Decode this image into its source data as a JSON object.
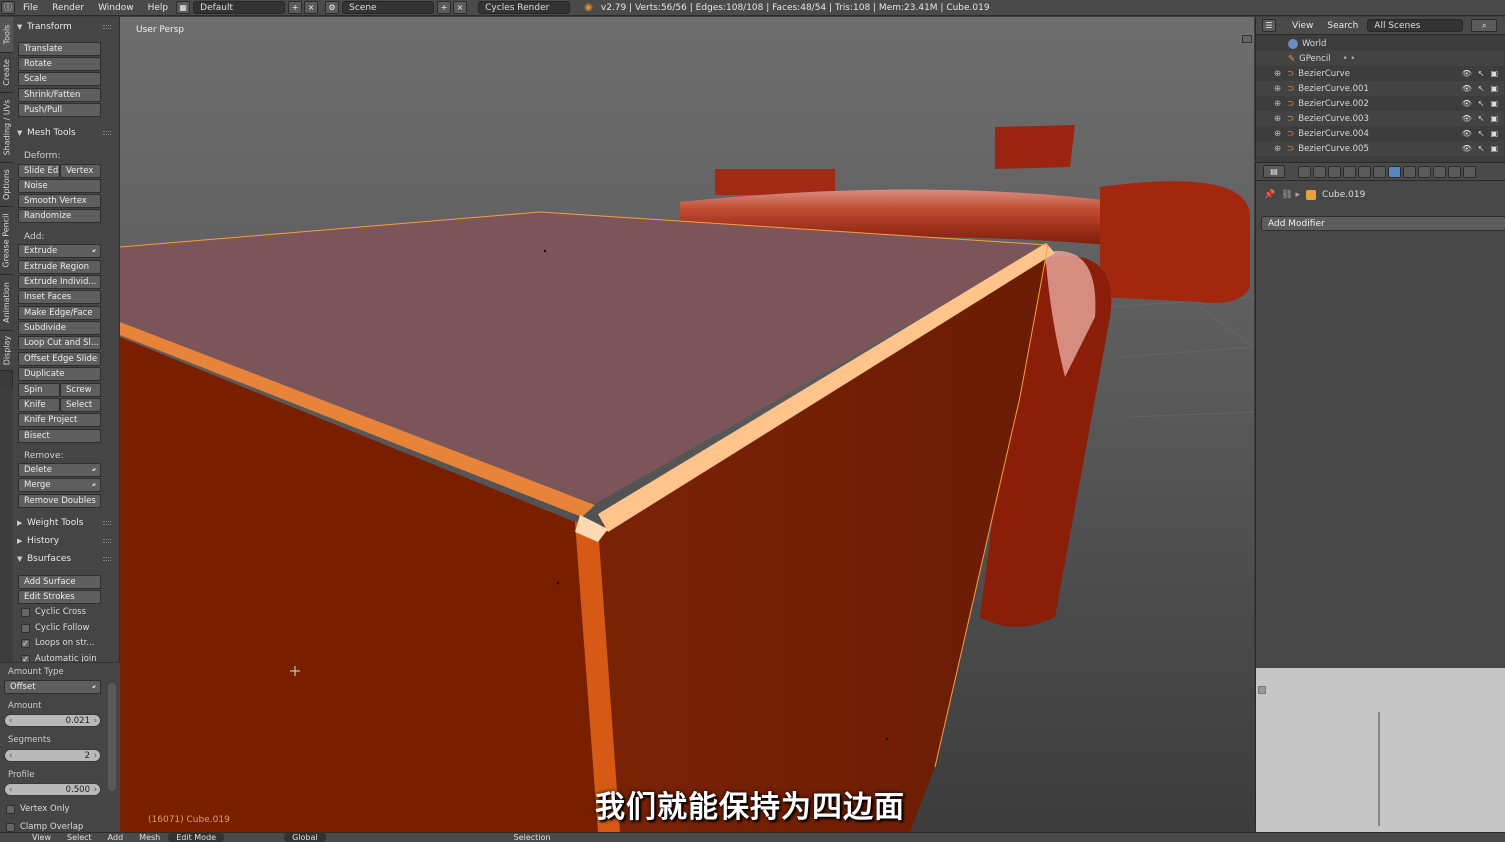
{
  "topbar": {
    "menus": [
      "File",
      "Render",
      "Window",
      "Help"
    ],
    "layout": "Default",
    "scene": "Scene",
    "engine": "Cycles Render",
    "stats": "v2.79 | Verts:56/56 | Edges:108/108 | Faces:48/54 | Tris:108 | Mem:23.41M | Cube.019"
  },
  "vtabs": [
    "Tools",
    "Create",
    "Shading / UVs",
    "Options",
    "Grease Pencil",
    "Animation",
    "Display"
  ],
  "toolshelf": {
    "transform": {
      "title": "Transform",
      "buttons": [
        "Translate",
        "Rotate",
        "Scale",
        "Shrink/Fatten",
        "Push/Pull"
      ]
    },
    "mesh_tools": {
      "title": "Mesh Tools",
      "deform_label": "Deform:",
      "slide_edge": "Slide Ed",
      "vertex": "Vertex",
      "noise": "Noise",
      "smooth_vertex": "Smooth Vertex",
      "randomize": "Randomize",
      "add_label": "Add:",
      "extrude": "Extrude",
      "extrude_region": "Extrude Region",
      "extrude_individual": "Extrude Individ...",
      "inset_faces": "Inset Faces",
      "make_edge_face": "Make Edge/Face",
      "subdivide": "Subdivide",
      "loop_cut": "Loop Cut and Sl...",
      "offset_edge_slide": "Offset Edge Slide",
      "duplicate": "Duplicate",
      "spin": "Spin",
      "screw": "Screw",
      "knife": "Knife",
      "select": "Select",
      "knife_project": "Knife Project",
      "bisect": "Bisect",
      "remove_label": "Remove:",
      "delete": "Delete",
      "merge": "Merge",
      "remove_doubles": "Remove Doubles"
    },
    "weight_tools": "Weight Tools",
    "history": "History",
    "bsurfaces": {
      "title": "Bsurfaces",
      "add_surface": "Add Surface",
      "edit_strokes": "Edit Strokes",
      "cyclic_cross": "Cyclic Cross",
      "cyclic_follow": "Cyclic Follow",
      "loops_on_strokes": "Loops on str...",
      "automatic_join": "Automatic join"
    },
    "operator": {
      "amount_type_label": "Amount Type",
      "amount_type_value": "Offset",
      "amount_label": "Amount",
      "amount_value": "0.021",
      "segments_label": "Segments",
      "segments_value": "2",
      "profile_label": "Profile",
      "profile_value": "0.500",
      "vertex_only": "Vertex Only",
      "clamp_overlap": "Clamp Overlap"
    }
  },
  "viewport": {
    "view_name": "User Persp",
    "object_info": "(16071) Cube.019",
    "subtitle": "我们就能保持为四边面",
    "colors": {
      "selected_face": "#7a1e00",
      "top_face": "#7c555a",
      "edge_highlight": "#ffa040"
    }
  },
  "outliner": {
    "view": "View",
    "search": "Search",
    "scope": "All Scenes",
    "items": [
      "World",
      "GPencil",
      "BezierCurve",
      "BezierCurve.001",
      "BezierCurve.002",
      "BezierCurve.003",
      "BezierCurve.004",
      "BezierCurve.005"
    ]
  },
  "properties": {
    "context_object": "Cube.019",
    "add_modifier": "Add Modifier"
  },
  "bottombar": {
    "items": [
      "View",
      "Select",
      "Add",
      "Mesh",
      "Edit Mode",
      "Global",
      "Selection"
    ]
  }
}
